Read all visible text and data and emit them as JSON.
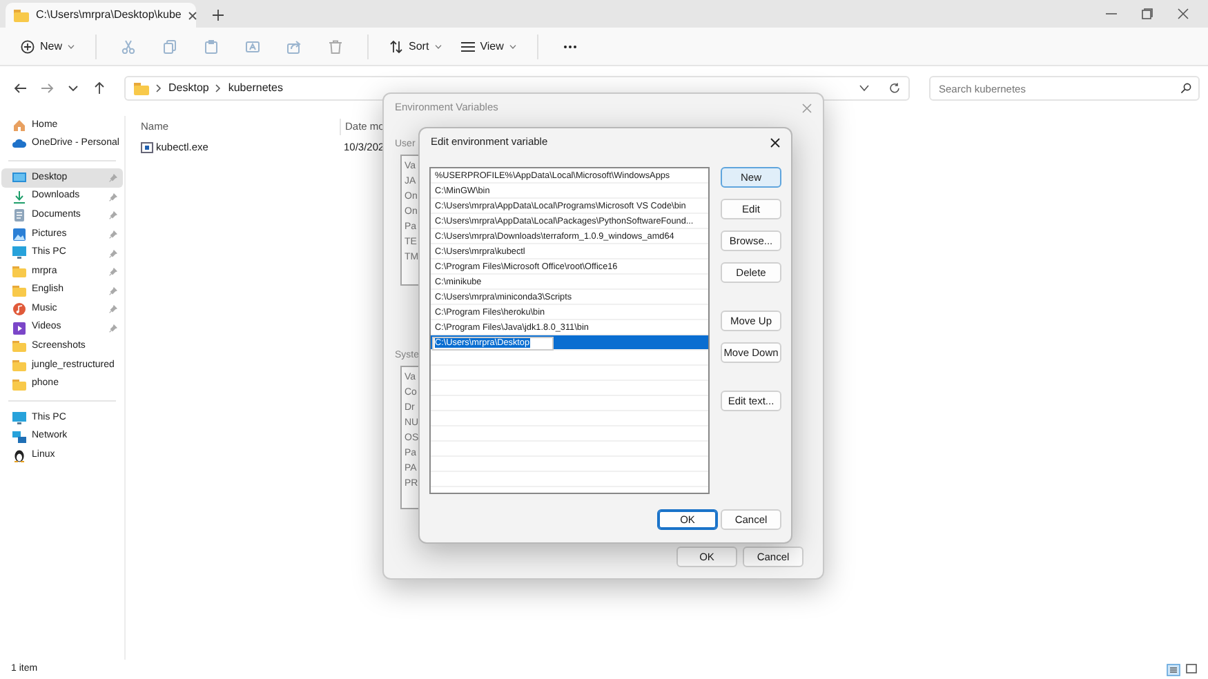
{
  "tab": {
    "title": "C:\\Users\\mrpra\\Desktop\\kube"
  },
  "toolbar": [
    {
      "kind": "new",
      "label": "New"
    },
    {
      "kind": "divider"
    },
    {
      "kind": "cut"
    },
    {
      "kind": "copy"
    },
    {
      "kind": "paste"
    },
    {
      "kind": "rename"
    },
    {
      "kind": "share"
    },
    {
      "kind": "delete"
    },
    {
      "kind": "divider"
    },
    {
      "kind": "sort",
      "label": "Sort"
    },
    {
      "kind": "view",
      "label": "View"
    },
    {
      "kind": "divider"
    },
    {
      "kind": "more"
    }
  ],
  "address": {
    "crumbs": [
      "Desktop",
      "kubernetes"
    ]
  },
  "search": {
    "placeholder": "Search kubernetes"
  },
  "sidebar": {
    "groups": [
      [
        {
          "label": "Home",
          "kind": "home",
          "pinned": false,
          "selected": false
        },
        {
          "label": "OneDrive - Personal",
          "kind": "cloud",
          "pinned": false,
          "selected": false
        }
      ],
      [
        {
          "label": "Desktop",
          "kind": "desktop",
          "pinned": true,
          "selected": true
        },
        {
          "label": "Downloads",
          "kind": "download",
          "pinned": true,
          "selected": false
        },
        {
          "label": "Documents",
          "kind": "document",
          "pinned": true,
          "selected": false
        },
        {
          "label": "Pictures",
          "kind": "picture",
          "pinned": true,
          "selected": false
        },
        {
          "label": "This PC",
          "kind": "pc",
          "pinned": true,
          "selected": false
        },
        {
          "label": "mrpra",
          "kind": "folder",
          "pinned": true,
          "selected": false
        },
        {
          "label": "English",
          "kind": "folder",
          "pinned": true,
          "selected": false
        },
        {
          "label": "Music",
          "kind": "music",
          "pinned": true,
          "selected": false
        },
        {
          "label": "Videos",
          "kind": "video",
          "pinned": true,
          "selected": false
        },
        {
          "label": "Screenshots",
          "kind": "folder",
          "pinned": false,
          "selected": false
        },
        {
          "label": "jungle_restructured",
          "kind": "folder",
          "pinned": false,
          "selected": false
        },
        {
          "label": "phone",
          "kind": "folder",
          "pinned": false,
          "selected": false
        }
      ],
      [
        {
          "label": "This PC",
          "kind": "pc",
          "pinned": false,
          "selected": false
        },
        {
          "label": "Network",
          "kind": "network",
          "pinned": false,
          "selected": false
        },
        {
          "label": "Linux",
          "kind": "linux",
          "pinned": false,
          "selected": false
        }
      ]
    ]
  },
  "files": {
    "columns": [
      "Name",
      "Date mo"
    ],
    "rows": [
      {
        "cells": [
          "kubectl.exe",
          "10/3/202"
        ]
      }
    ]
  },
  "status_bar": {
    "count": "1 item"
  },
  "env_dialog": {
    "title": "Environment Variables",
    "user_label": "User",
    "user_rows": [
      "Va",
      "JA",
      "On",
      "On",
      "Pa",
      "TE",
      "TM"
    ],
    "system_label": "Syste",
    "system_rows": [
      "Va",
      "Co",
      "Dr",
      "NU",
      "OS",
      "Pa",
      "PA",
      "PR"
    ],
    "buttons": [
      "OK",
      "Cancel"
    ]
  },
  "edit_dialog": {
    "title": "Edit environment variable",
    "entries": [
      {
        "text": "%USERPROFILE%\\AppData\\Local\\Microsoft\\WindowsApps",
        "selected": false
      },
      {
        "text": "C:\\MinGW\\bin",
        "selected": false
      },
      {
        "text": "C:\\Users\\mrpra\\AppData\\Local\\Programs\\Microsoft VS Code\\bin",
        "selected": false
      },
      {
        "text": "C:\\Users\\mrpra\\AppData\\Local\\Packages\\PythonSoftwareFound...",
        "selected": false
      },
      {
        "text": "C:\\Users\\mrpra\\Downloads\\terraform_1.0.9_windows_amd64",
        "selected": false
      },
      {
        "text": "C:\\Users\\mrpra\\kubectl",
        "selected": false
      },
      {
        "text": "C:\\Program Files\\Microsoft Office\\root\\Office16",
        "selected": false
      },
      {
        "text": "C:\\minikube",
        "selected": false
      },
      {
        "text": "C:\\Users\\mrpra\\miniconda3\\Scripts",
        "selected": false
      },
      {
        "text": "C:\\Program Files\\heroku\\bin",
        "selected": false
      },
      {
        "text": "C:\\Program Files\\Java\\jdk1.8.0_311\\bin",
        "selected": false
      },
      {
        "text": "C:\\Users\\mrpra\\Desktop",
        "selected": true
      }
    ],
    "side_buttons": [
      {
        "label": "New",
        "focused": true
      },
      {
        "label": "Edit",
        "focused": false
      },
      {
        "label": "Browse...",
        "focused": false
      },
      {
        "label": "Delete",
        "focused": false
      },
      {
        "label": "Move Up",
        "focused": false
      },
      {
        "label": "Move Down",
        "focused": false
      },
      {
        "label": "Edit text...",
        "focused": false
      }
    ],
    "footer_buttons": [
      {
        "label": "OK",
        "default": true
      },
      {
        "label": "Cancel",
        "default": false
      }
    ]
  }
}
